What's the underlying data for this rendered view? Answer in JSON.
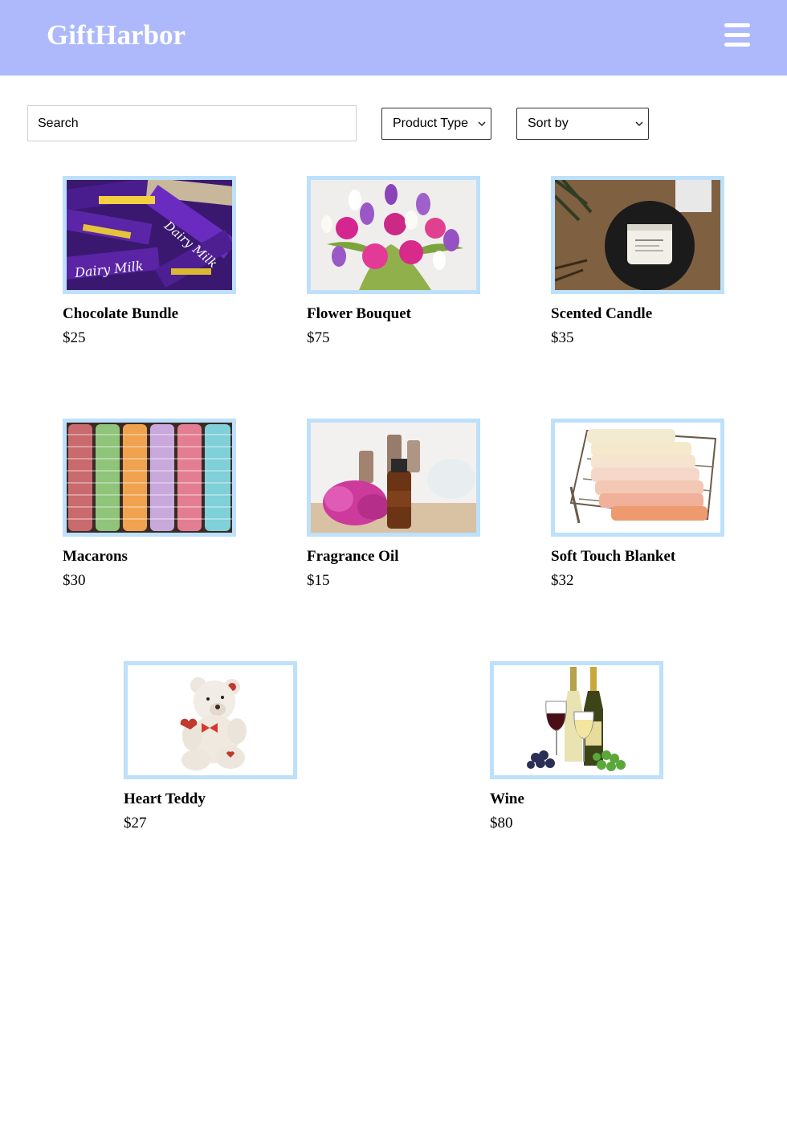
{
  "header": {
    "brand": "GiftHarbor",
    "menu_icon": "hamburger-menu-icon",
    "background_color": "#adb9fa"
  },
  "filters": {
    "search_placeholder": "Search",
    "product_type_label": "Product Type",
    "sort_by_label": "Sort by"
  },
  "products": [
    {
      "name": "Chocolate Bundle",
      "price": "$25"
    },
    {
      "name": "Flower Bouquet",
      "price": "$75"
    },
    {
      "name": "Scented Candle",
      "price": "$35"
    },
    {
      "name": "Macarons",
      "price": "$30"
    },
    {
      "name": "Fragrance Oil",
      "price": "$15"
    },
    {
      "name": "Soft Touch Blanket",
      "price": "$32"
    },
    {
      "name": "Heart Teddy",
      "price": "$27"
    },
    {
      "name": "Wine",
      "price": "$80"
    }
  ],
  "colors": {
    "image_border": "#bde0fb"
  }
}
